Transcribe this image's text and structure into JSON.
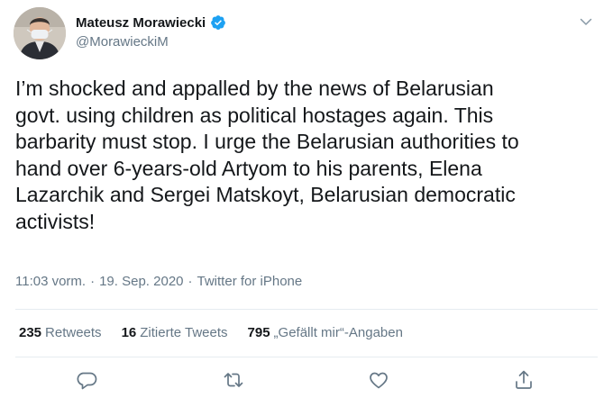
{
  "author": {
    "display_name": "Mateusz Morawiecki",
    "handle": "@MorawieckiM",
    "verified": true
  },
  "tweet": {
    "lines": [
      "I’m shocked and appalled by the news of Belarusian",
      "govt. using children as political hostages again. This",
      "barbarity must stop. I urge the Belarusian authorities to",
      "hand over 6-years-old Artyom to his parents, Elena",
      "Lazarchik and Sergei Matskoyt, Belarusian democratic",
      "activists!"
    ],
    "time": "11:03 vorm.",
    "date": "19. Sep. 2020",
    "separator": "·",
    "source": "Twitter for iPhone"
  },
  "stats": {
    "retweets_count": "235",
    "retweets_label": "Retweets",
    "quotes_count": "16",
    "quotes_label": "Zitierte Tweets",
    "likes_count": "795",
    "likes_label": "„Gefällt mir“-Angaben"
  },
  "colors": {
    "text": "#14171a",
    "secondary": "#657786",
    "verified_blue": "#1da1f2",
    "divider": "#e6ecf0"
  },
  "icons": {
    "menu": "chevron-down-icon",
    "reply": "reply-icon",
    "retweet": "retweet-icon",
    "like": "heart-icon",
    "share": "share-icon"
  }
}
